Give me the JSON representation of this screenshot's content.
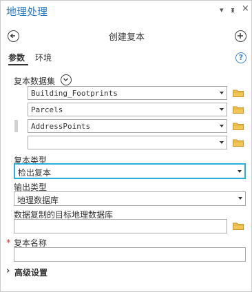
{
  "window": {
    "title": "地理处理",
    "dropdown_glyph": "▾",
    "pin_glyph": "ᵻ",
    "close_glyph": "×"
  },
  "nav": {
    "title": "创建复本",
    "back_icon": "back-arrow-icon",
    "add_icon": "plus-icon"
  },
  "tabs": [
    {
      "label": "参数",
      "active": true
    },
    {
      "label": "环境",
      "active": false
    }
  ],
  "help_glyph": "?",
  "replica_datasets": {
    "label": "复本数据集",
    "items": [
      {
        "value": "Building_Footprints"
      },
      {
        "value": "Parcels"
      },
      {
        "value": "AddressPoints"
      },
      {
        "value": ""
      }
    ]
  },
  "replica_type": {
    "label": "复本类型",
    "value": "检出复本"
  },
  "output_type": {
    "label": "输出类型",
    "value": "地理数据库"
  },
  "target_gdb": {
    "label": "数据复制的目标地理数据库",
    "value": ""
  },
  "replica_name": {
    "label": "复本名称",
    "required_mark": "*",
    "value": ""
  },
  "advanced": {
    "label": "高级设置",
    "expander_glyph": "›"
  },
  "colors": {
    "title_blue": "#2a7ac8",
    "highlight_border": "#2aaee0",
    "folder_yellow": "#e6b33b",
    "required_red": "#c0392b"
  }
}
